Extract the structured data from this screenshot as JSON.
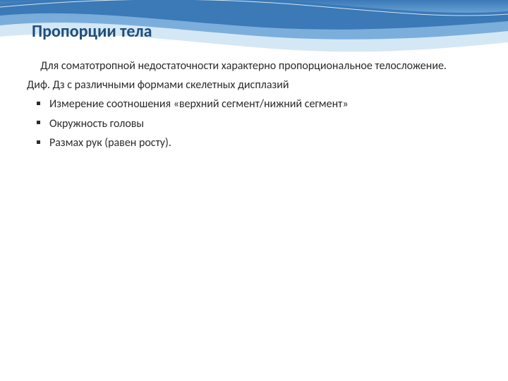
{
  "title": "Пропорции тела",
  "paragraph1": "Для соматотропной недостаточности характерно пропорциональное телосложение.",
  "paragraph2": "Диф. Дз с различными формами скелетных дисплазий",
  "bullets": [
    "Измерение соотношения «верхний сегмент/нижний сегмент»",
    "Окружность головы",
    "Размах рук (равен росту)."
  ],
  "colors": {
    "title": "#1f4e79",
    "sky_top": "#3b79b7",
    "sky_mid": "#6ba3d6",
    "sky_light": "#cfe4f4"
  }
}
